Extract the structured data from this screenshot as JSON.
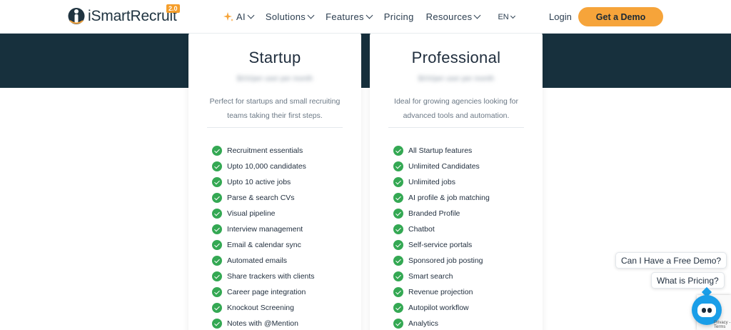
{
  "brand": {
    "name": "iSmartRecruit",
    "badge": "2.0",
    "colors": {
      "accent": "#f6a43a",
      "dark_band": "#17303d",
      "check": "#34a853",
      "bot": "#1a9ee8"
    }
  },
  "nav": {
    "items": [
      {
        "label": "AI",
        "icon": "sparkle-icon",
        "has_dropdown": true
      },
      {
        "label": "Solutions",
        "has_dropdown": true
      },
      {
        "label": "Features",
        "has_dropdown": true
      },
      {
        "label": "Pricing",
        "has_dropdown": false
      },
      {
        "label": "Resources",
        "has_dropdown": true
      }
    ],
    "language": "EN",
    "login": "Login",
    "demo_button": "Get a Demo"
  },
  "plans": [
    {
      "title": "Startup",
      "price": "$XX/per user per month",
      "description": "Perfect for startups and small recruiting teams taking their first steps.",
      "features": [
        "Recruitment essentials",
        "Upto 10,000 candidates",
        "Upto 10 active jobs",
        "Parse & search CVs",
        "Visual pipeline",
        "Interview management",
        "Email & calendar sync",
        "Automated emails",
        "Share trackers with clients",
        "Career page integration",
        "Knockout Screening",
        "Notes with @Mention"
      ]
    },
    {
      "title": "Professional",
      "price": "$XX/per user per month",
      "description": "Ideal for growing agencies looking for advanced tools and automation.",
      "features": [
        "All Startup features",
        "Unlimited Candidates",
        "Unlimited jobs",
        "AI profile & job matching",
        "Branded Profile",
        "Chatbot",
        "Self-service portals",
        "Sponsored job posting",
        "Smart search",
        "Revenue projection",
        "Autopilot workflow",
        "Analytics"
      ]
    }
  ],
  "chat": {
    "questions": [
      "Can I Have a Free Demo?",
      "What is Pricing?"
    ],
    "recaptcha_label": "Privacy - Terms"
  }
}
